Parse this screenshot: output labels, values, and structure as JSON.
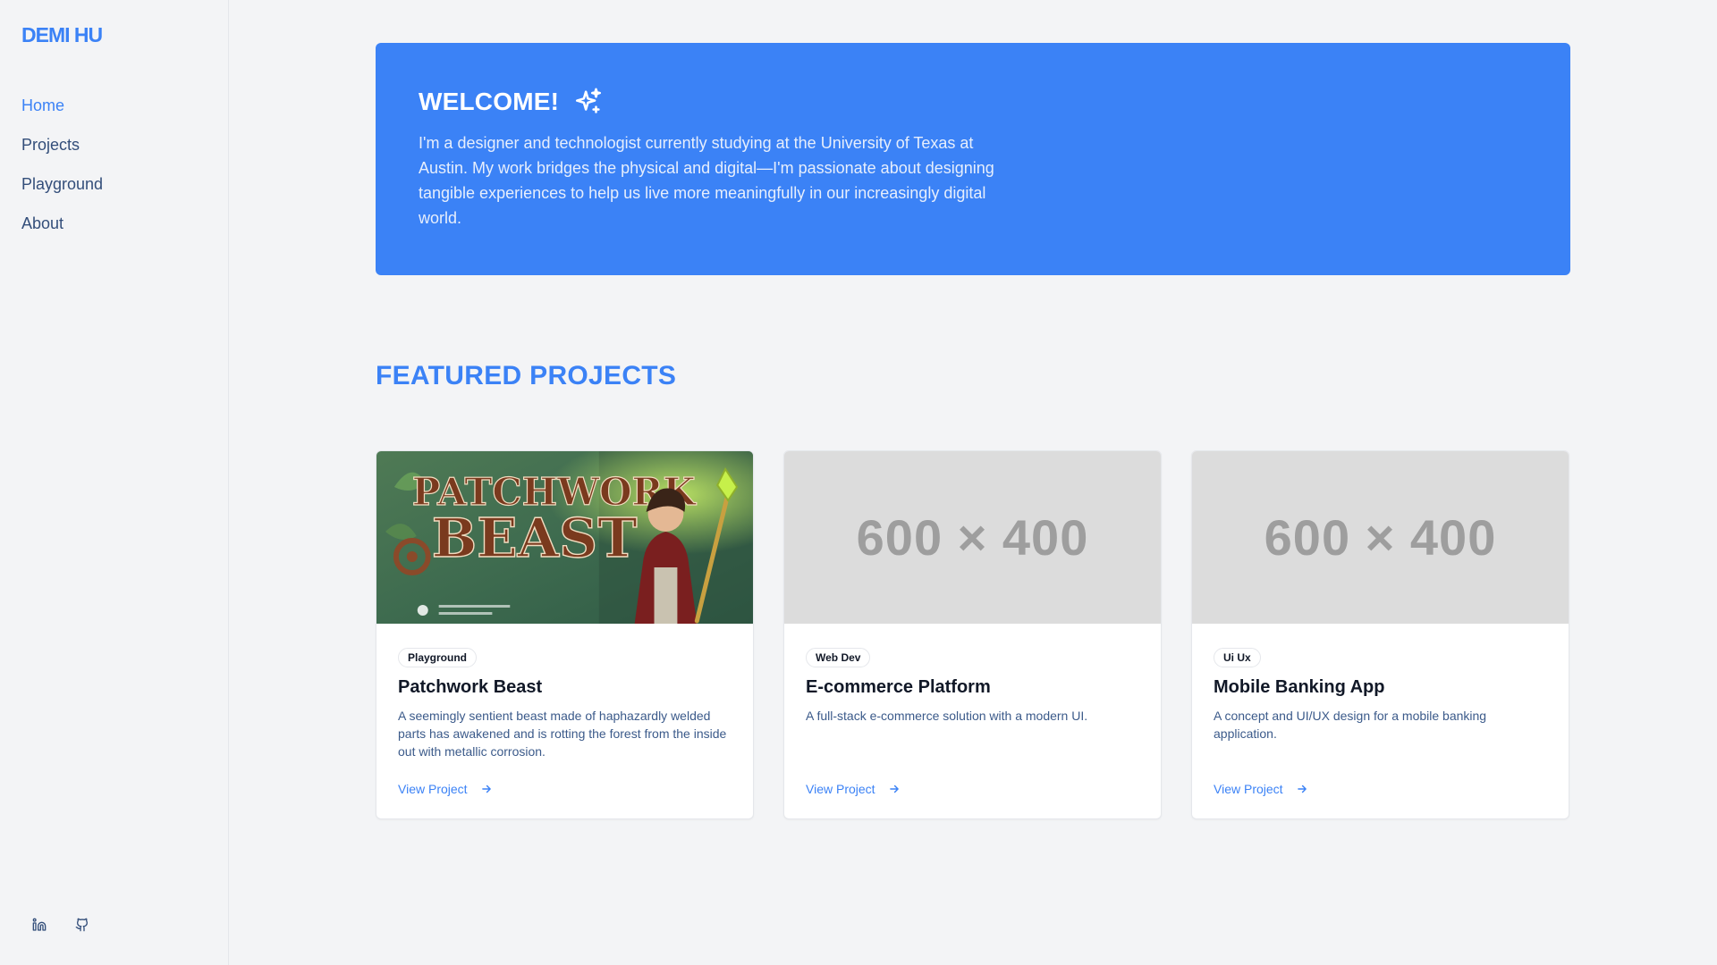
{
  "sidebar": {
    "brand": "DEMI HU",
    "nav": [
      {
        "label": "Home",
        "active": true
      },
      {
        "label": "Projects",
        "active": false
      },
      {
        "label": "Playground",
        "active": false
      },
      {
        "label": "About",
        "active": false
      }
    ],
    "socials": [
      {
        "icon": "linkedin-icon"
      },
      {
        "icon": "github-icon"
      }
    ]
  },
  "hero": {
    "title": "WELCOME!",
    "icon": "sparkles-icon",
    "text": "I'm a designer and technologist currently studying at the University of Texas at Austin. My work bridges the physical and digital—I'm passionate about designing tangible experiences to help us live more meaningfully in our increasingly digital world."
  },
  "featured": {
    "title": "FEATURED PROJECTS",
    "projects": [
      {
        "tag": "Playground",
        "title": "Patchwork Beast",
        "description": "A seemingly sentient beast made of haphazardly welded parts has awakened and is rotting the forest from the inside out with metallic corrosion.",
        "link": "View Project",
        "image_title_line1": "PATCHWORK",
        "image_title_line2": "BEAST"
      },
      {
        "tag": "Web Dev",
        "title": "E-commerce Platform",
        "description": "A full-stack e-commerce solution with a modern UI.",
        "link": "View Project",
        "placeholder": "600 × 400"
      },
      {
        "tag": "Ui Ux",
        "title": "Mobile Banking App",
        "description": "A concept and UI/UX design for a mobile banking application.",
        "link": "View Project",
        "placeholder": "600 × 400"
      }
    ]
  },
  "colors": {
    "accent": "#3b82f6",
    "background": "#f3f4f6",
    "placeholder": "#dcdcdc"
  }
}
